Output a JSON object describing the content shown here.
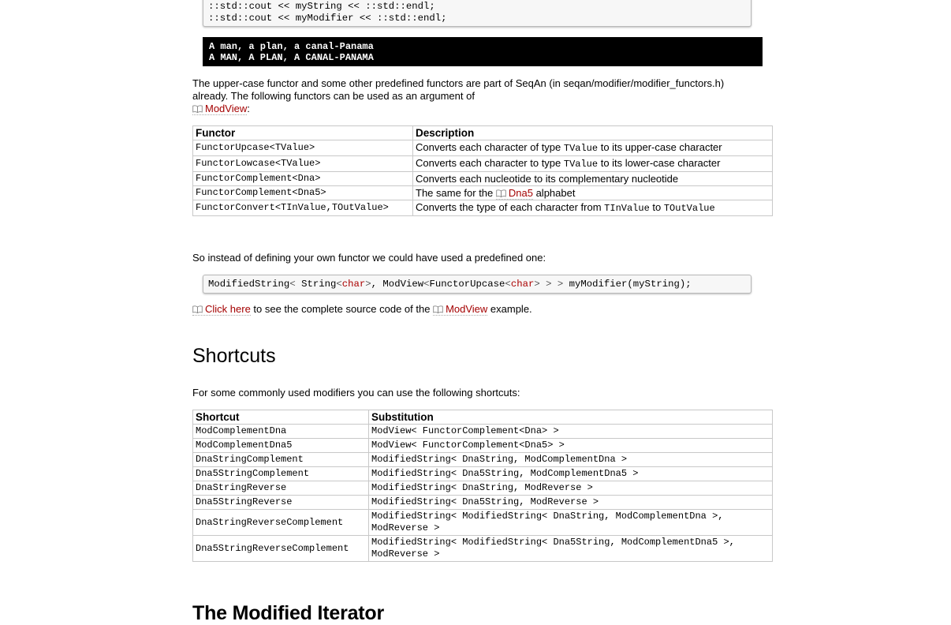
{
  "top_code": {
    "lines": [
      "::std::cout << myString << ::std::endl;",
      "::std::cout << myModifier << ::std::endl;"
    ]
  },
  "console": {
    "lines": [
      "A man, a plan, a canal-Panama",
      "A MAN, A PLAN, A CANAL-PANAMA"
    ]
  },
  "intro": {
    "text1": "The upper-case functor and some other predefined functors are part of SeqAn (in seqan/modifier/modifier_functors.h) already. The following functors can be used as an argument of",
    "link": "ModView",
    "text2": ":"
  },
  "functor_table": {
    "headers": [
      "Functor",
      "Description"
    ],
    "rows": [
      {
        "functor": "FunctorUpcase<TValue>",
        "d1": "Converts each character of type ",
        "code": "TValue",
        "d2": " to its upper-case character"
      },
      {
        "functor": "FunctorLowcase<TValue>",
        "d1": "Converts each character to type ",
        "code": "TValue",
        "d2": " to its lower-case character"
      },
      {
        "functor": "FunctorComplement<Dna>",
        "d1": "Converts each nucleotide to its complementary nucleotide"
      },
      {
        "functor": "FunctorComplement<Dna5>",
        "d1": "The same for the ",
        "link": "Dna5",
        "d2": " alphabet"
      },
      {
        "functor": "FunctorConvert<TInValue,TOutValue>",
        "d1": "Converts the type of each character from ",
        "code": "TInValue",
        "d2": " to ",
        "code2": "TOutValue"
      }
    ]
  },
  "instead_text": "So instead of defining your own functor we could have used a predefined one:",
  "mid_code": {
    "part1": "ModifiedString",
    "part2": "< ",
    "part3": "String",
    "part4": "<",
    "kw1": "char",
    "part5": ">",
    "part6": ", ModView",
    "part7": "<",
    "part8": "FunctorUpcase",
    "part9": "<",
    "kw2": "char",
    "part10": "> > >",
    "part11": " myModifier(myString);"
  },
  "click_line": {
    "link1": "Click here",
    "text1": " to see the complete source code of the ",
    "link2": "ModView",
    "text2": " example."
  },
  "shortcuts_heading": "Shortcuts",
  "shortcuts_intro": "For some commonly used modifiers you can use the following shortcuts:",
  "shortcut_table": {
    "headers": [
      "Shortcut",
      "Substitution"
    ],
    "rows": [
      {
        "shortcut": "ModComplementDna",
        "subst": "ModView< FunctorComplement<Dna> >"
      },
      {
        "shortcut": "ModComplementDna5",
        "subst": "ModView< FunctorComplement<Dna5> >"
      },
      {
        "shortcut": "DnaStringComplement",
        "subst": "ModifiedString< DnaString, ModComplementDna >"
      },
      {
        "shortcut": "Dna5StringComplement",
        "subst": "ModifiedString< Dna5String, ModComplementDna5 >"
      },
      {
        "shortcut": "DnaStringReverse",
        "subst": "ModifiedString< DnaString, ModReverse >"
      },
      {
        "shortcut": "Dna5StringReverse",
        "subst": "ModifiedString< Dna5String, ModReverse >"
      },
      {
        "shortcut": "DnaStringReverseComplement",
        "subst": "ModifiedString< ModifiedString< DnaString, ModComplementDna >, ModReverse >"
      },
      {
        "shortcut": "Dna5StringReverseComplement",
        "subst": "ModifiedString< ModifiedString< Dna5String, ModComplementDna5 >, ModReverse >"
      }
    ]
  },
  "iterator_heading": "The Modified Iterator"
}
